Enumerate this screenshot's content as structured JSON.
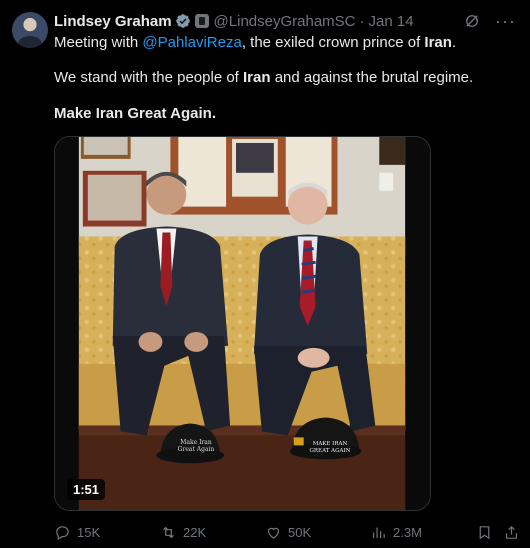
{
  "author": {
    "name": "Lindsey Graham",
    "handle": "@LindseyGrahamSC",
    "separator": "·",
    "date": "Jan 14"
  },
  "post": {
    "line1_prefix": "Meeting with ",
    "line1_mention": "@PahlaviReza",
    "line1_middle": ", the exiled crown prince of ",
    "line1_bold": "Iran",
    "line1_end": ".",
    "line2_prefix": "We stand with the people of ",
    "line2_bold": "Iran",
    "line2_end": " and against the brutal regime.",
    "line3_bold": "Make Iran Great Again."
  },
  "media": {
    "duration": "1:51",
    "hat_left": "Make Iran Great Again",
    "hat_right": "MAKE IRAN GREAT AGAIN"
  },
  "actions": {
    "replies": "15K",
    "reposts": "22K",
    "likes": "50K",
    "views": "2.3M"
  },
  "icons": {
    "verified": "verified-check-icon",
    "government": "government-badge-icon",
    "grok": "grok-icon",
    "more": "more-dots-icon",
    "reply": "reply-icon",
    "repost": "repost-icon",
    "like": "heart-icon",
    "views": "views-bar-chart-icon",
    "bookmark": "bookmark-icon",
    "share": "share-icon"
  },
  "colors": {
    "background": "#000000",
    "text": "#e7e9ea",
    "secondary": "#71767b",
    "link": "#1d9bf0",
    "verified": "#829aab"
  }
}
